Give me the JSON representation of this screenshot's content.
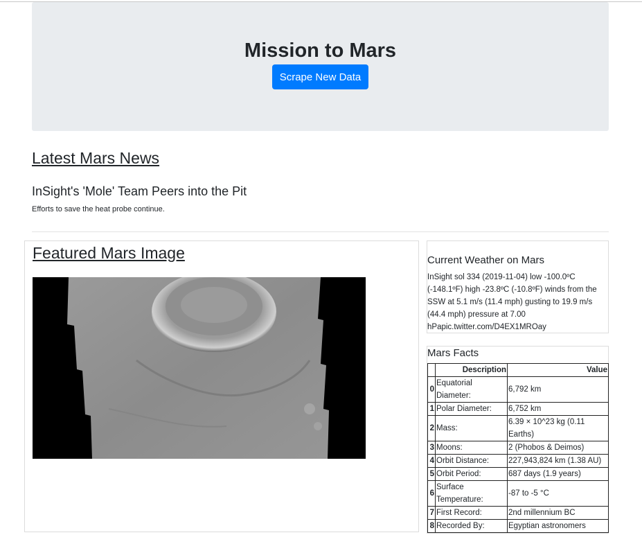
{
  "header": {
    "title": "Mission to Mars",
    "scrape_button": "Scrape New Data"
  },
  "news": {
    "section_title": "Latest Mars News",
    "headline": "InSight's 'Mole' Team Peers into the Pit",
    "teaser": "Efforts to save the heat probe continue."
  },
  "featured_image": {
    "section_title": "Featured Mars Image"
  },
  "weather": {
    "title": "Current Weather on Mars",
    "text": "InSight sol 334 (2019-11-04) low -100.0ºC (-148.1ºF) high -23.8ºC (-10.8ºF) winds from the SSW at 5.1 m/s (11.4 mph) gusting to 19.9 m/s (44.4 mph) pressure at 7.00 hPapic.twitter.com/D4EX1MROay"
  },
  "facts": {
    "title": "Mars Facts",
    "headers": [
      "",
      "Description",
      "Value"
    ],
    "rows": [
      {
        "index": "0",
        "description": "Equatorial Diameter:",
        "value": "6,792 km"
      },
      {
        "index": "1",
        "description": "Polar Diameter:",
        "value": "6,752 km"
      },
      {
        "index": "2",
        "description": "Mass:",
        "value": "6.39 × 10^23 kg (0.11 Earths)"
      },
      {
        "index": "3",
        "description": "Moons:",
        "value": "2 (Phobos & Deimos)"
      },
      {
        "index": "4",
        "description": "Orbit Distance:",
        "value": "227,943,824 km (1.38 AU)"
      },
      {
        "index": "5",
        "description": "Orbit Period:",
        "value": "687 days (1.9 years)"
      },
      {
        "index": "6",
        "description": "Surface Temperature:",
        "value": "-87 to -5 °C"
      },
      {
        "index": "7",
        "description": "First Record:",
        "value": "2nd millennium BC"
      },
      {
        "index": "8",
        "description": "Recorded By:",
        "value": "Egyptian astronomers"
      }
    ]
  }
}
